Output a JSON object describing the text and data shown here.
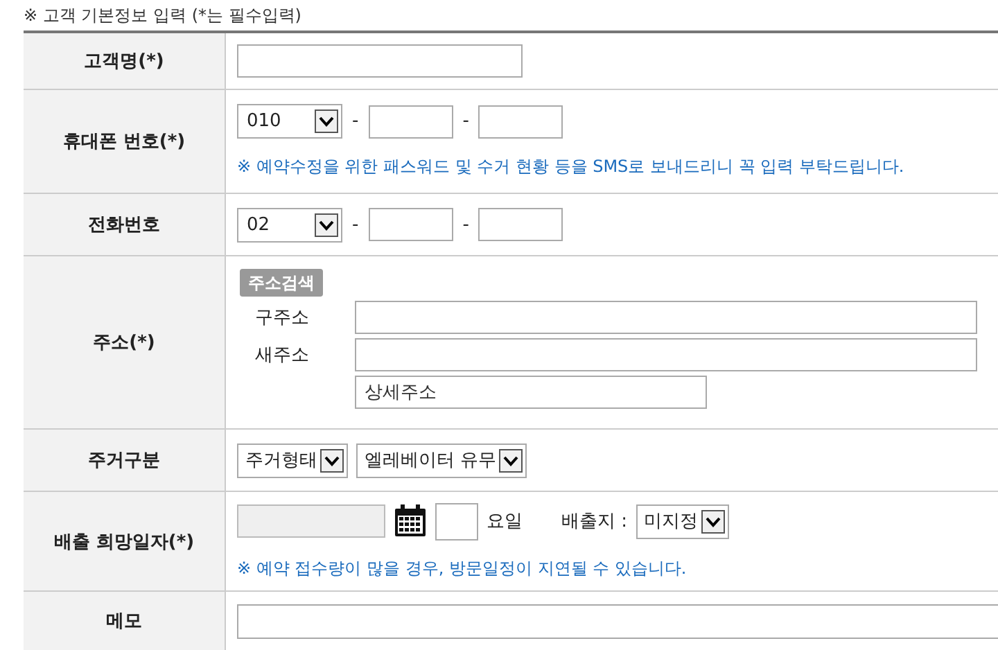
{
  "title": "※ 고객 기본정보 입력 (*는 필수입력)",
  "rows": [
    {
      "kind": "text",
      "label": "고객명(*)"
    },
    {
      "kind": "phone",
      "label": "휴대폰 번호(*)",
      "prefix": "010",
      "separator": "-",
      "note": "※ 예약수정을 위한 패스워드 및 수거 현황 등을 SMS로 보내드리니 꼭 입력 부탁드립니다."
    },
    {
      "kind": "phone",
      "label": "전화번호",
      "prefix": "02",
      "separator": "-"
    },
    {
      "kind": "address",
      "label": "주소(*)",
      "search_button": "주소검색",
      "old_label": "구주소",
      "new_label": "새주소",
      "detail_placeholder": "상세주소"
    },
    {
      "kind": "selects",
      "label": "주거구분",
      "selects": [
        "주거형태",
        "엘레베이터 유무"
      ]
    },
    {
      "kind": "date",
      "label": "배출 희망일자(*)",
      "day_label": "요일",
      "place_label": "배출지 :",
      "place_value": "미지정",
      "note": "※ 예약 접수량이 많을 경우, 방문일정이 지연될 수 있습니다."
    },
    {
      "kind": "memo",
      "label": "메모"
    }
  ]
}
